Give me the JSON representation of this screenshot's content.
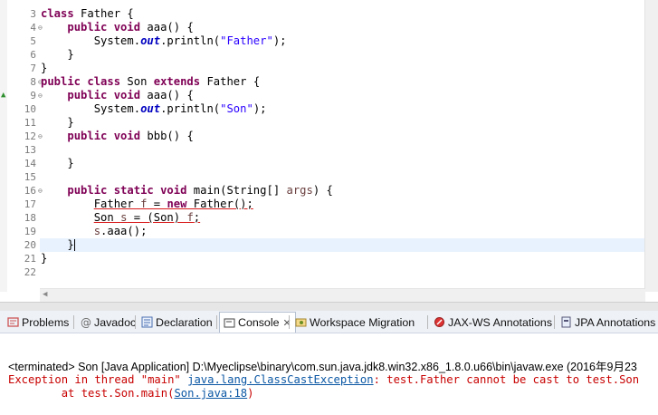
{
  "editor": {
    "lines": [
      {
        "num": "3",
        "fold": "",
        "overlay": "",
        "html": "<span class=\"kw\">class</span> Father {"
      },
      {
        "num": "4",
        "fold": "⊖",
        "overlay": "",
        "html": "    <span class=\"kw\">public void</span> aaa() {"
      },
      {
        "num": "5",
        "fold": "",
        "overlay": "",
        "html": "        System.<span class=\"fld\">out</span>.println(<span class=\"str\">\"Father\"</span>);"
      },
      {
        "num": "6",
        "fold": "",
        "overlay": "",
        "html": "    }"
      },
      {
        "num": "7",
        "fold": "",
        "overlay": "",
        "html": "}"
      },
      {
        "num": "8",
        "fold": "⊖",
        "overlay": "",
        "html": "<span class=\"kw\">public class</span> Son <span class=\"kw\">extends</span> Father {"
      },
      {
        "num": "9",
        "fold": "⊖",
        "overlay": "▲",
        "html": "    <span class=\"kw\">public void</span> aaa() {"
      },
      {
        "num": "10",
        "fold": "",
        "overlay": "",
        "html": "        System.<span class=\"fld\">out</span>.println(<span class=\"str\">\"Son\"</span>);"
      },
      {
        "num": "11",
        "fold": "",
        "overlay": "",
        "html": "    }"
      },
      {
        "num": "12",
        "fold": "⊖",
        "overlay": "",
        "html": "    <span class=\"kw\">public void</span> bbb() {"
      },
      {
        "num": "13",
        "fold": "",
        "overlay": "",
        "html": ""
      },
      {
        "num": "14",
        "fold": "",
        "overlay": "",
        "html": "    }"
      },
      {
        "num": "15",
        "fold": "",
        "overlay": "",
        "html": ""
      },
      {
        "num": "16",
        "fold": "⊖",
        "overlay": "",
        "html": "    <span class=\"kw\">public static void</span> main(String[] <span class=\"var\">args</span>) {"
      },
      {
        "num": "17",
        "fold": "",
        "overlay": "",
        "html": "        <span class=\"err\">Father <span class=\"var\">f</span> = <span class=\"kw\">new</span> Father();</span>"
      },
      {
        "num": "18",
        "fold": "",
        "overlay": "",
        "html": "        <span class=\"err\">Son <span class=\"var\">s</span> = (Son) <span class=\"var\">f</span>;</span>"
      },
      {
        "num": "19",
        "fold": "",
        "overlay": "",
        "html": "        <span class=\"var\">s</span>.aaa();"
      },
      {
        "num": "20",
        "fold": "",
        "overlay": "",
        "html": "    }<span class=\"caret\"></span>"
      },
      {
        "num": "21",
        "fold": "",
        "overlay": "",
        "html": "}"
      },
      {
        "num": "22",
        "fold": "",
        "overlay": "",
        "html": ""
      }
    ],
    "current_line_index": 17
  },
  "tabs": [
    {
      "label": "Problems",
      "name": "tab-problems",
      "icon": "problems-icon",
      "active": false,
      "close": false
    },
    {
      "label": "Javadoc",
      "name": "tab-javadoc",
      "icon": "javadoc-icon",
      "active": false,
      "close": false
    },
    {
      "label": "Declaration",
      "name": "tab-declaration",
      "icon": "declaration-icon",
      "active": false,
      "close": false
    },
    {
      "label": "Console",
      "name": "tab-console",
      "icon": "console-icon",
      "active": true,
      "close": true
    },
    {
      "label": "Workspace Migration",
      "name": "tab-workspace-migration",
      "icon": "migration-icon",
      "active": false,
      "close": false
    },
    {
      "label": "JAX-WS Annotations",
      "name": "tab-jaxws-annotations",
      "icon": "jaxws-icon",
      "active": false,
      "close": false
    },
    {
      "label": "JPA Annotations",
      "name": "tab-jpa-annotations",
      "icon": "jpa-icon",
      "active": false,
      "close": false
    }
  ],
  "console": {
    "header": "<terminated> Son [Java Application] D:\\Myeclipse\\binary\\com.sun.java.jdk8.win32.x86_1.8.0.u66\\bin\\javaw.exe (2016年9月23",
    "line1_prefix": "Exception in thread \"main\" ",
    "line1_link": "java.lang.ClassCastException",
    "line1_suffix": ": test.Father cannot be cast to test.Son",
    "line2_prefix": "        at test.Son.main(",
    "line2_link": "Son.java:18",
    "line2_suffix": ")"
  },
  "colors": {
    "error_text": "#c80000",
    "link": "#0b57a4",
    "keyword": "#7f0055",
    "string": "#2a00ff",
    "current_line": "#e8f2fe"
  }
}
